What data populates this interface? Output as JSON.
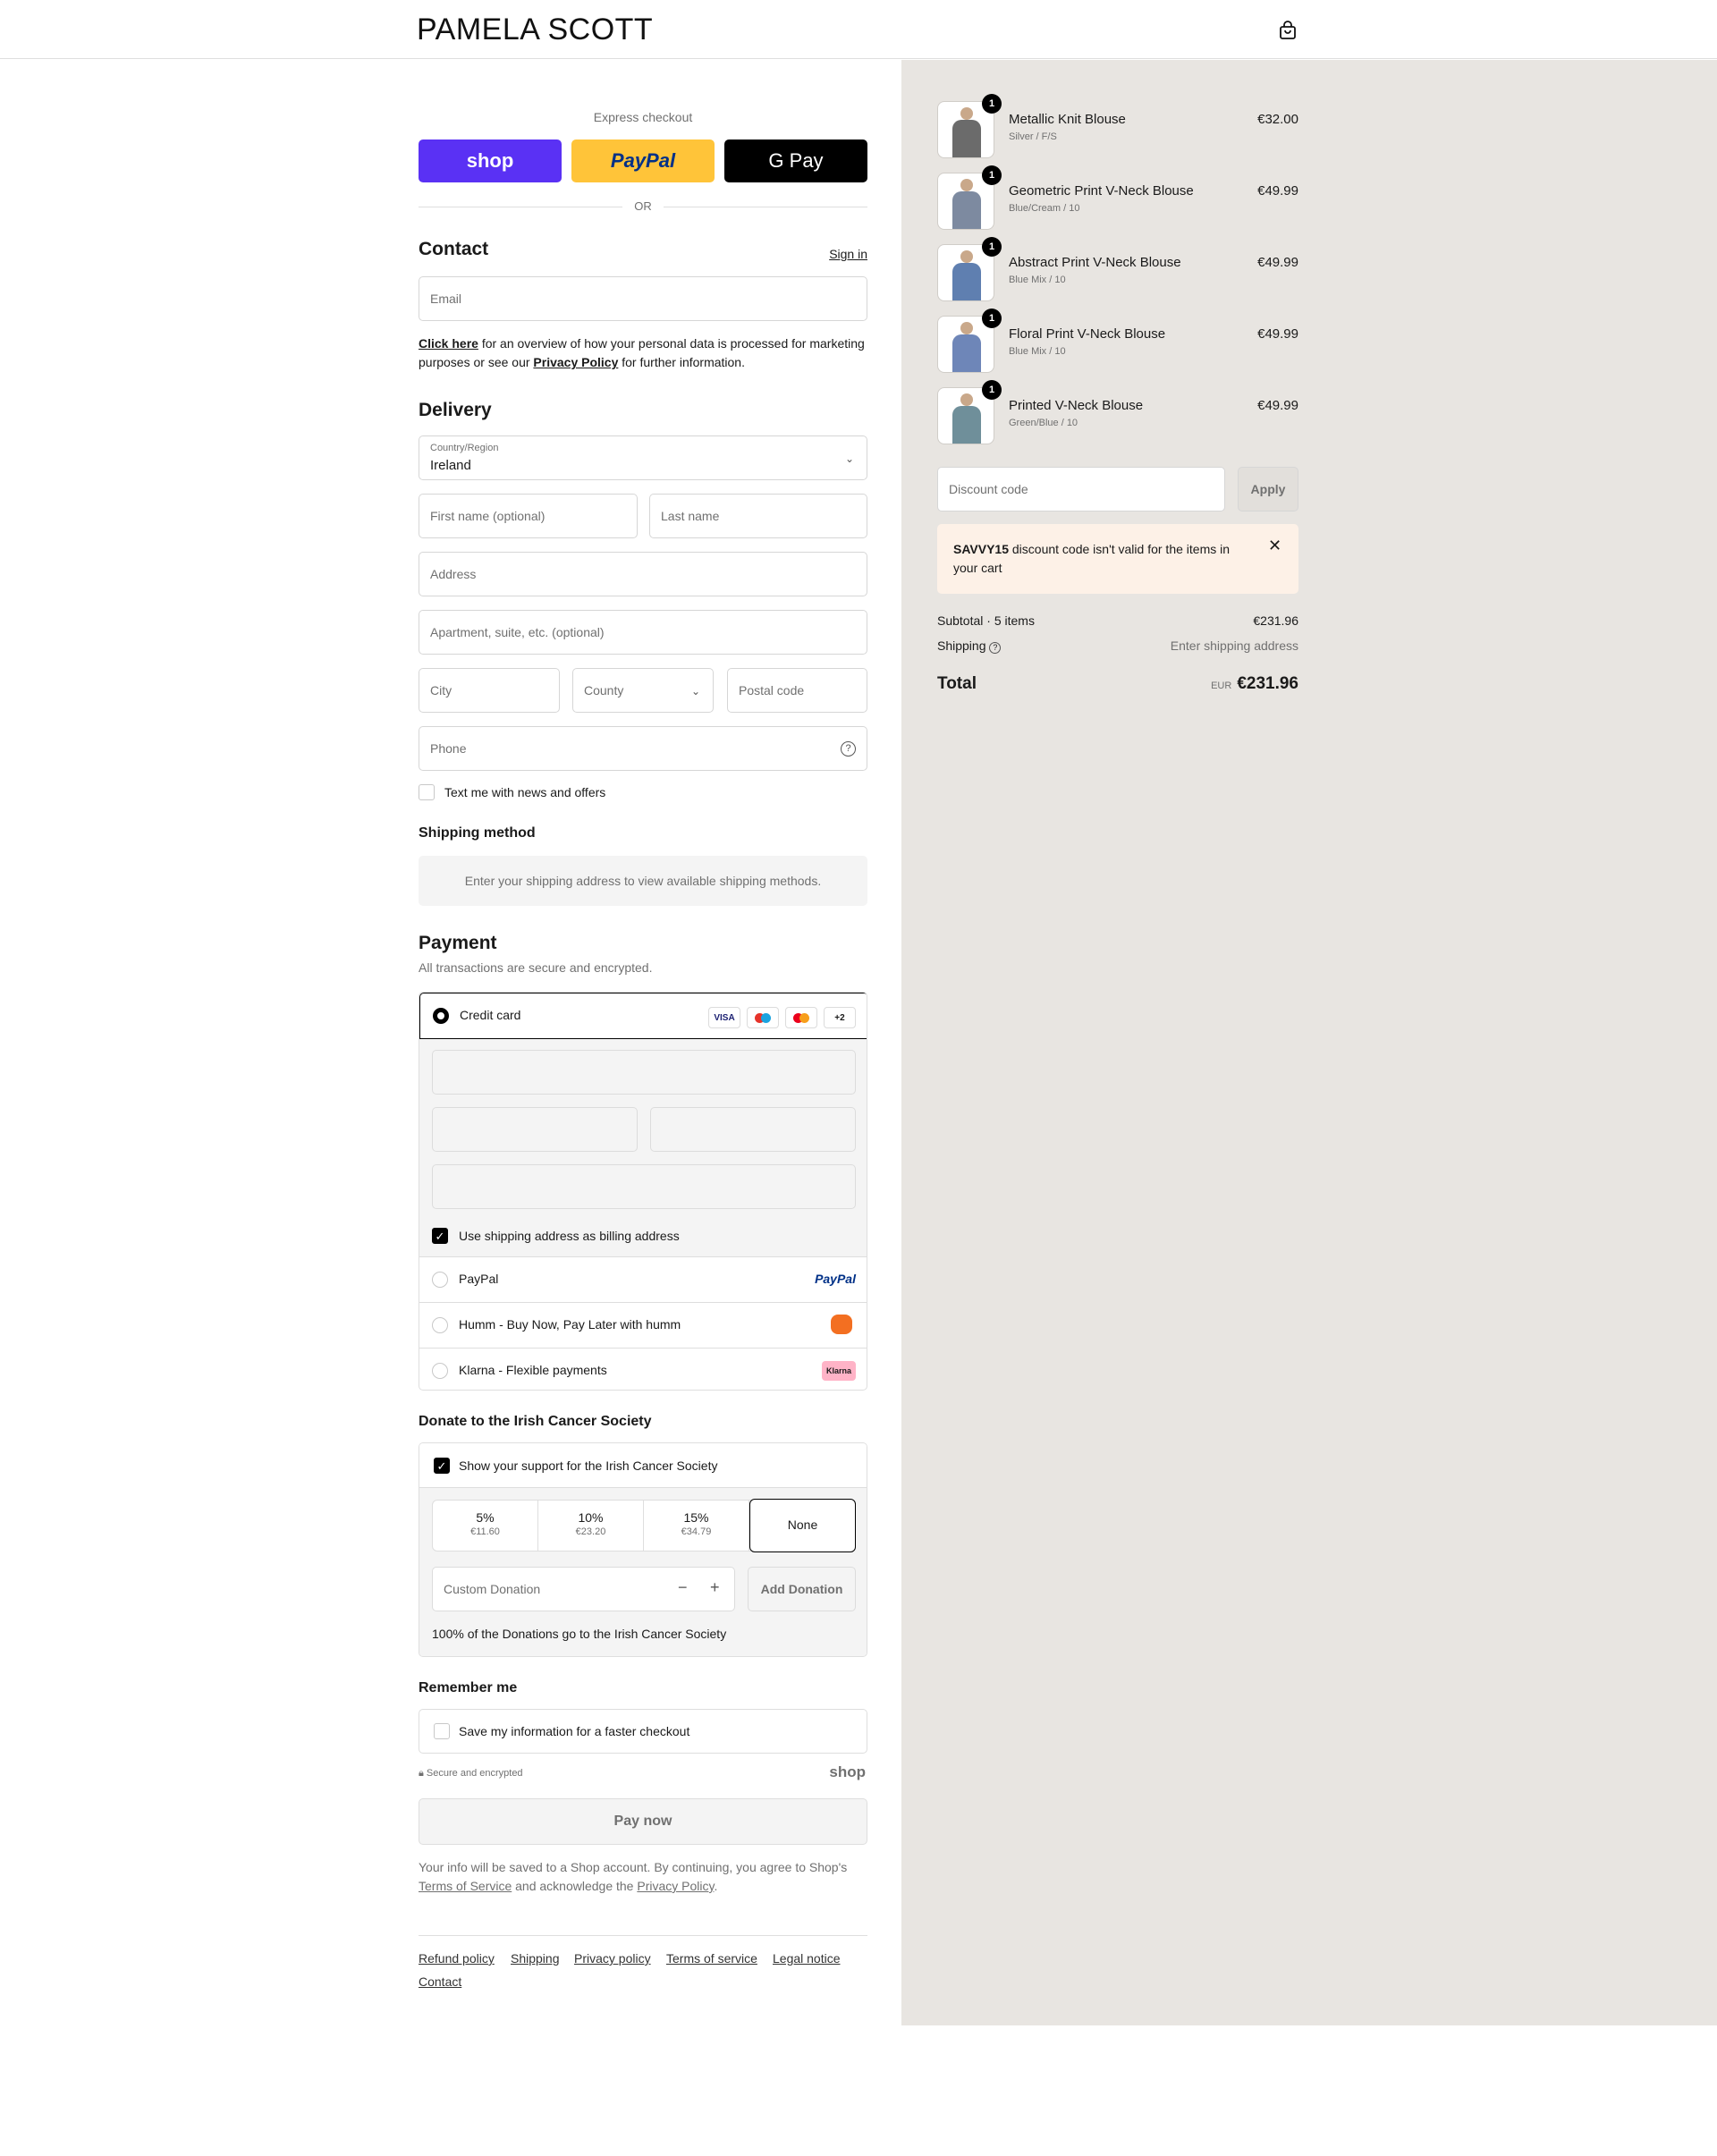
{
  "header": {
    "brand": "PAMELA SCOTT",
    "cart_icon": "shopping-bag-icon"
  },
  "express": {
    "label": "Express checkout",
    "buttons": [
      {
        "label": "shop"
      },
      {
        "label": "PayPal"
      },
      {
        "label": "G Pay"
      }
    ],
    "or": "OR"
  },
  "contact": {
    "title": "Contact",
    "sign_in": "Sign in",
    "email_placeholder": "Email",
    "privacy_click": "Click here",
    "privacy_text1": " for an overview of how your personal data is processed for marketing purposes or see our ",
    "privacy_link": "Privacy Policy",
    "privacy_text2": " for further information."
  },
  "delivery": {
    "title": "Delivery",
    "country_label": "Country/Region",
    "country_value": "Ireland",
    "first_name": "First name (optional)",
    "last_name": "Last name",
    "address": "Address",
    "apartment": "Apartment, suite, etc. (optional)",
    "city": "City",
    "county": "County",
    "postal": "Postal code",
    "phone": "Phone",
    "text_me": "Text me with news and offers"
  },
  "shipping_method": {
    "title": "Shipping method",
    "notice": "Enter your shipping address to view available shipping methods."
  },
  "payment": {
    "title": "Payment",
    "subtitle": "All transactions are secure and encrypted.",
    "credit_card": "Credit card",
    "card_badges": [
      "VISA",
      "",
      "",
      "+2"
    ],
    "billing_same": "Use shipping address as billing address",
    "options": [
      {
        "label": "PayPal",
        "logo": "PayPal"
      },
      {
        "label": "Humm - Buy Now, Pay Later with humm",
        "logo": ""
      },
      {
        "label": "Klarna - Flexible payments",
        "logo": "Klarna"
      }
    ]
  },
  "donate": {
    "title": "Donate to the Irish Cancer Society",
    "support": "Show your support for the Irish Cancer Society",
    "options": [
      {
        "pct": "5%",
        "amt": "€11.60"
      },
      {
        "pct": "10%",
        "amt": "€23.20"
      },
      {
        "pct": "15%",
        "amt": "€34.79"
      }
    ],
    "none": "None",
    "custom_placeholder": "Custom Donation",
    "add": "Add Donation",
    "note": "100% of the Donations go to the Irish Cancer Society"
  },
  "remember": {
    "title": "Remember me",
    "save": "Save my information for a faster checkout",
    "secure": "Secure and encrypted",
    "shop": "shop"
  },
  "pay_now": "Pay now",
  "terms": {
    "text1": "Your info will be saved to a Shop account. By continuing, you agree to Shop's ",
    "tos": "Terms of Service",
    "text2": " and acknowledge the ",
    "privacy": "Privacy Policy",
    "text3": "."
  },
  "footer_links": [
    "Refund policy",
    "Shipping",
    "Privacy policy",
    "Terms of service",
    "Legal notice",
    "Contact"
  ],
  "order": {
    "items": [
      {
        "qty": "1",
        "name": "Metallic Knit Blouse",
        "variant": "Silver / F/S",
        "price": "€32.00",
        "color": "#6b6b6b"
      },
      {
        "qty": "1",
        "name": "Geometric Print V-Neck Blouse",
        "variant": "Blue/Cream / 10",
        "price": "€49.99",
        "color": "#7d8aa0"
      },
      {
        "qty": "1",
        "name": "Abstract Print V-Neck Blouse",
        "variant": "Blue Mix / 10",
        "price": "€49.99",
        "color": "#5f7fb0"
      },
      {
        "qty": "1",
        "name": "Floral Print V-Neck Blouse",
        "variant": "Blue Mix / 10",
        "price": "€49.99",
        "color": "#6e86b8"
      },
      {
        "qty": "1",
        "name": "Printed V-Neck Blouse",
        "variant": "Green/Blue / 10",
        "price": "€49.99",
        "color": "#6f8f9a"
      }
    ],
    "discount_placeholder": "Discount code",
    "apply": "Apply",
    "alert_code": "SAVVY15",
    "alert_text": " discount code isn't valid for the items in your cart",
    "subtotal_label": "Subtotal · 5 items",
    "subtotal": "€231.96",
    "shipping_label": "Shipping",
    "shipping_value": "Enter shipping address",
    "total_label": "Total",
    "currency": "EUR",
    "total": "€231.96"
  }
}
